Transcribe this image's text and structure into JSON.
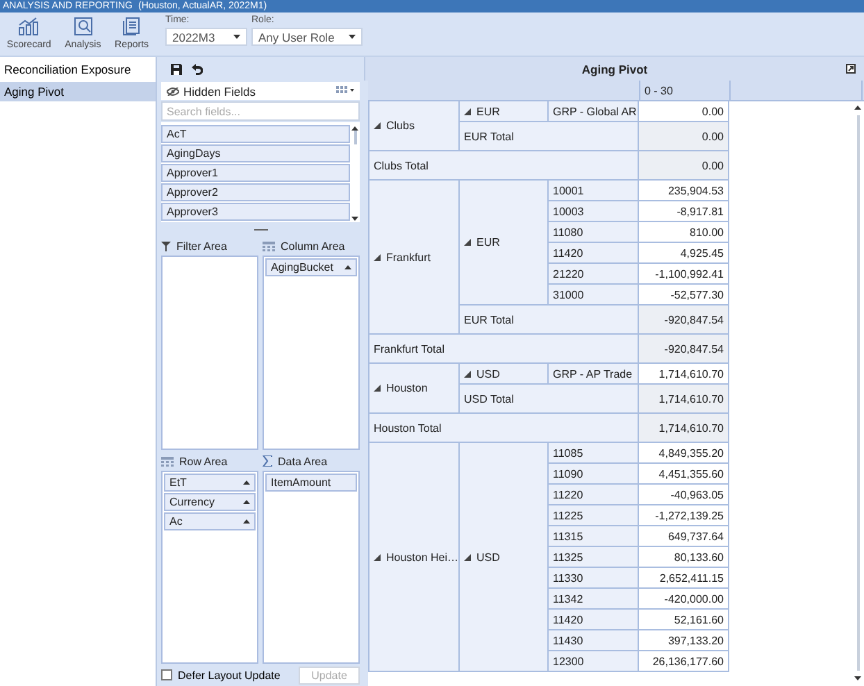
{
  "window": {
    "title": "ANALYSIS AND REPORTING",
    "context": "(Houston, ActualAR, 2022M1)"
  },
  "toolbar": [
    {
      "label": "Scorecard",
      "kind": "scorecard"
    },
    {
      "label": "Analysis",
      "kind": "analysis"
    },
    {
      "label": "Reports",
      "kind": "reports"
    }
  ],
  "filters": [
    {
      "label": "Time:",
      "value": "2022M3"
    },
    {
      "label": "Role:",
      "value": "Any User Role"
    }
  ],
  "sidebar": {
    "items": [
      {
        "label": "Reconciliation Exposure",
        "selected": false
      },
      {
        "label": "Aging Pivot",
        "selected": true
      }
    ]
  },
  "field_list": {
    "title": "Hidden Fields",
    "search": {
      "placeholder": "Search fields..."
    },
    "fields": [
      "AcT",
      "AgingDays",
      "Approver1",
      "Approver2",
      "Approver3"
    ],
    "areas": [
      {
        "kind": "filter",
        "title": "Filter Area"
      },
      {
        "kind": "column",
        "title": "Column Area",
        "fields": [
          "AgingBucket"
        ]
      },
      {
        "kind": "row",
        "title": "Row Area",
        "fields": [
          "EtT",
          "Currency",
          "Ac"
        ]
      },
      {
        "kind": "data",
        "title": "Data Area",
        "fields": [
          "ItemAmount"
        ]
      }
    ],
    "defer_update": {
      "label": "Defer Layout Update",
      "checked": false
    },
    "update_button": {
      "label": "Update",
      "disabled": true
    }
  },
  "pivot": {
    "title": "Aging Pivot",
    "columns": [
      "0 - 30"
    ],
    "groups": [
      {
        "label": "Clubs",
        "expanded": true,
        "total_label": "Clubs Total",
        "total": "0.00",
        "currencies": [
          {
            "label": "EUR",
            "expanded": true,
            "total_label": "EUR Total",
            "total": "0.00",
            "rows": [
              {
                "account": "GRP - Global AR",
                "value": "0.00"
              }
            ]
          }
        ]
      },
      {
        "label": "Frankfurt",
        "expanded": true,
        "total_label": "Frankfurt Total",
        "total": "-920,847.54",
        "currencies": [
          {
            "label": "EUR",
            "expanded": true,
            "total_label": "EUR Total",
            "total": "-920,847.54",
            "rows": [
              {
                "account": "10001",
                "value": "235,904.53"
              },
              {
                "account": "10003",
                "value": "-8,917.81"
              },
              {
                "account": "11080",
                "value": "810.00"
              },
              {
                "account": "11420",
                "value": "4,925.45"
              },
              {
                "account": "21220",
                "value": "-1,100,992.41"
              },
              {
                "account": "31000",
                "value": "-52,577.30"
              }
            ]
          }
        ]
      },
      {
        "label": "Houston",
        "expanded": true,
        "total_label": "Houston Total",
        "total": "1,714,610.70",
        "currencies": [
          {
            "label": "USD",
            "expanded": true,
            "total_label": "USD Total",
            "total": "1,714,610.70",
            "rows": [
              {
                "account": "GRP - AP Trade",
                "value": "1,714,610.70"
              }
            ]
          }
        ]
      },
      {
        "label": "Houston Hei…",
        "expanded": true,
        "currencies": [
          {
            "label": "USD",
            "expanded": true,
            "rows": [
              {
                "account": "11085",
                "value": "4,849,355.20"
              },
              {
                "account": "11090",
                "value": "4,451,355.60"
              },
              {
                "account": "11220",
                "value": "-40,963.05"
              },
              {
                "account": "11225",
                "value": "-1,272,139.25"
              },
              {
                "account": "11315",
                "value": "649,737.64"
              },
              {
                "account": "11325",
                "value": "80,133.60"
              },
              {
                "account": "11330",
                "value": "2,652,411.15"
              },
              {
                "account": "11342",
                "value": "-420,000.00"
              },
              {
                "account": "11420",
                "value": "52,161.60"
              },
              {
                "account": "11430",
                "value": "397,133.20"
              },
              {
                "account": "12300",
                "value": "26,136,177.60"
              }
            ]
          }
        ]
      }
    ]
  }
}
